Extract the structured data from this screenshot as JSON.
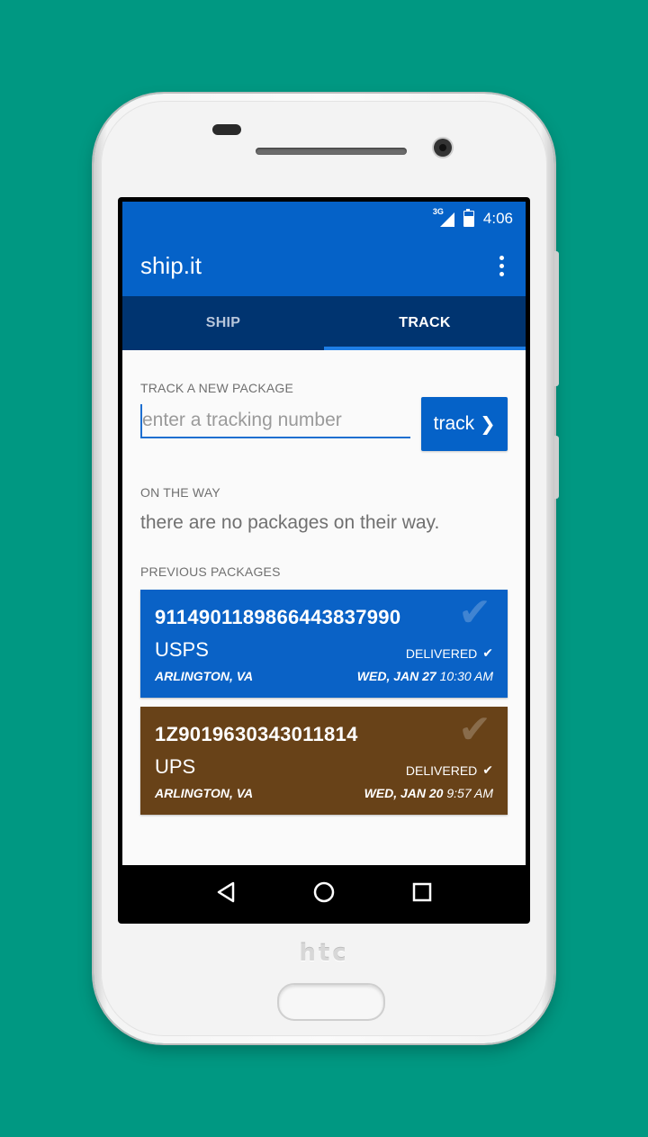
{
  "device": {
    "brand": "htc"
  },
  "status_bar": {
    "network": "3G",
    "time": "4:06"
  },
  "app_bar": {
    "title": "ship.it",
    "menu_icon": "overflow-vertical-icon"
  },
  "tabs": [
    {
      "label": "SHIP",
      "active": false
    },
    {
      "label": "TRACK",
      "active": true
    }
  ],
  "track": {
    "section_label": "TRACK A NEW PACKAGE",
    "placeholder": "enter a tracking number",
    "button_label": "track",
    "button_icon": "❯"
  },
  "on_the_way": {
    "section_label": "ON THE WAY",
    "empty_message": "there are no packages on their way."
  },
  "previous": {
    "section_label": "PREVIOUS PACKAGES",
    "packages": [
      {
        "tracking_number": "9114901189866443837990",
        "carrier": "USPS",
        "status": "DELIVERED",
        "location": "ARLINGTON, VA",
        "date": "WED, JAN 27",
        "time": "10:30 AM",
        "color": "#0a62c6"
      },
      {
        "tracking_number": "1Z9019630343011814",
        "carrier": "UPS",
        "status": "DELIVERED",
        "location": "ARLINGTON, VA",
        "date": "WED, JAN 20",
        "time": "9:57 AM",
        "color": "#684218"
      }
    ]
  },
  "colors": {
    "background": "#009882",
    "primary": "#0562c8",
    "tab_bar": "#003470",
    "ups_brown": "#684218"
  }
}
